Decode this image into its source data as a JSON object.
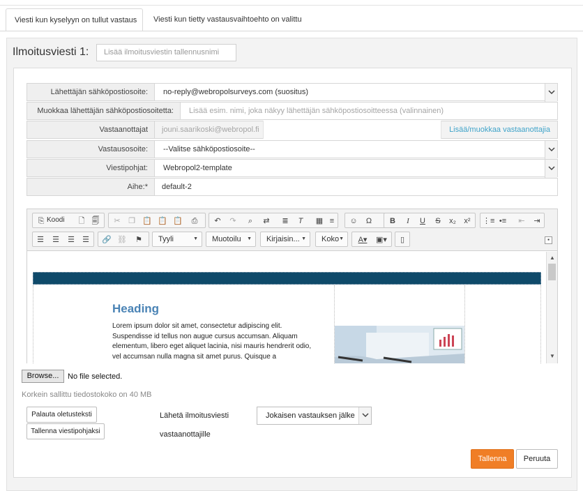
{
  "tabs": [
    {
      "label": "Viesti kun kyselyyn on tullut vastaus"
    },
    {
      "label": "Viesti kun tietty vastausvaihtoehto on valittu"
    }
  ],
  "notification": {
    "title": "Ilmoitusviesti 1:",
    "name_placeholder": "Lisää ilmoitusviestin tallennusnimi"
  },
  "form": {
    "sender_label": "Lähettäjän sähköpostiosoite:",
    "sender_value": "no-reply@webropolsurveys.com (suositus)",
    "edit_sender_label": "Muokkaa lähettäjän sähköpostiosoitetta:",
    "edit_sender_placeholder": "Lisää esim. nimi, joka näkyy lähettäjän sähköpostiosoitteessa (valinnainen)",
    "recipients_label": "Vastaanottajat",
    "recipients_value": "jouni.saarikoski@webropol.fi",
    "recipients_link": "Lisää/muokkaa vastaanottajia",
    "reply_label": "Vastausosoite:",
    "reply_value": "--Valitse sähköpostiosoite--",
    "template_label": "Viestipohjat:",
    "template_value": "Webropol2-template",
    "subject_label": "Aihe:*",
    "subject_value": "default-2"
  },
  "editor": {
    "source_label": "Koodi",
    "combos": {
      "style": "Tyyli",
      "format": "Muotoilu",
      "font": "Kirjaisin...",
      "size": "Koko"
    },
    "content_heading": "Heading",
    "content_text": "Lorem ipsum dolor sit amet, consectetur adipiscing elit. Suspendisse id tellus non augue cursus accumsan. Aliquam elementum, libero eget aliquet lacinia, nisi mauris hendrerit odio, vel accumsan nulla magna sit amet purus. Quisque a"
  },
  "upload": {
    "browse_label": "Browse...",
    "status": "No file selected.",
    "max_size": "Korkein sallittu tiedostokoko on 40 MB"
  },
  "actions": {
    "restore_default": "Palauta oletusteksti",
    "save_template": "Tallenna viestipohjaksi",
    "send_label_line1": "Lähetä ilmoitusviesti",
    "send_label_line2": "vastaanottajille",
    "send_option": "Jokaisen vastauksen jälke",
    "save": "Tallenna",
    "cancel": "Peruuta"
  },
  "colors": {
    "accent": "#f07e26",
    "link": "#3fa3c9",
    "heading_blue": "#4a83b5",
    "header_bar": "#0f4a6a"
  }
}
